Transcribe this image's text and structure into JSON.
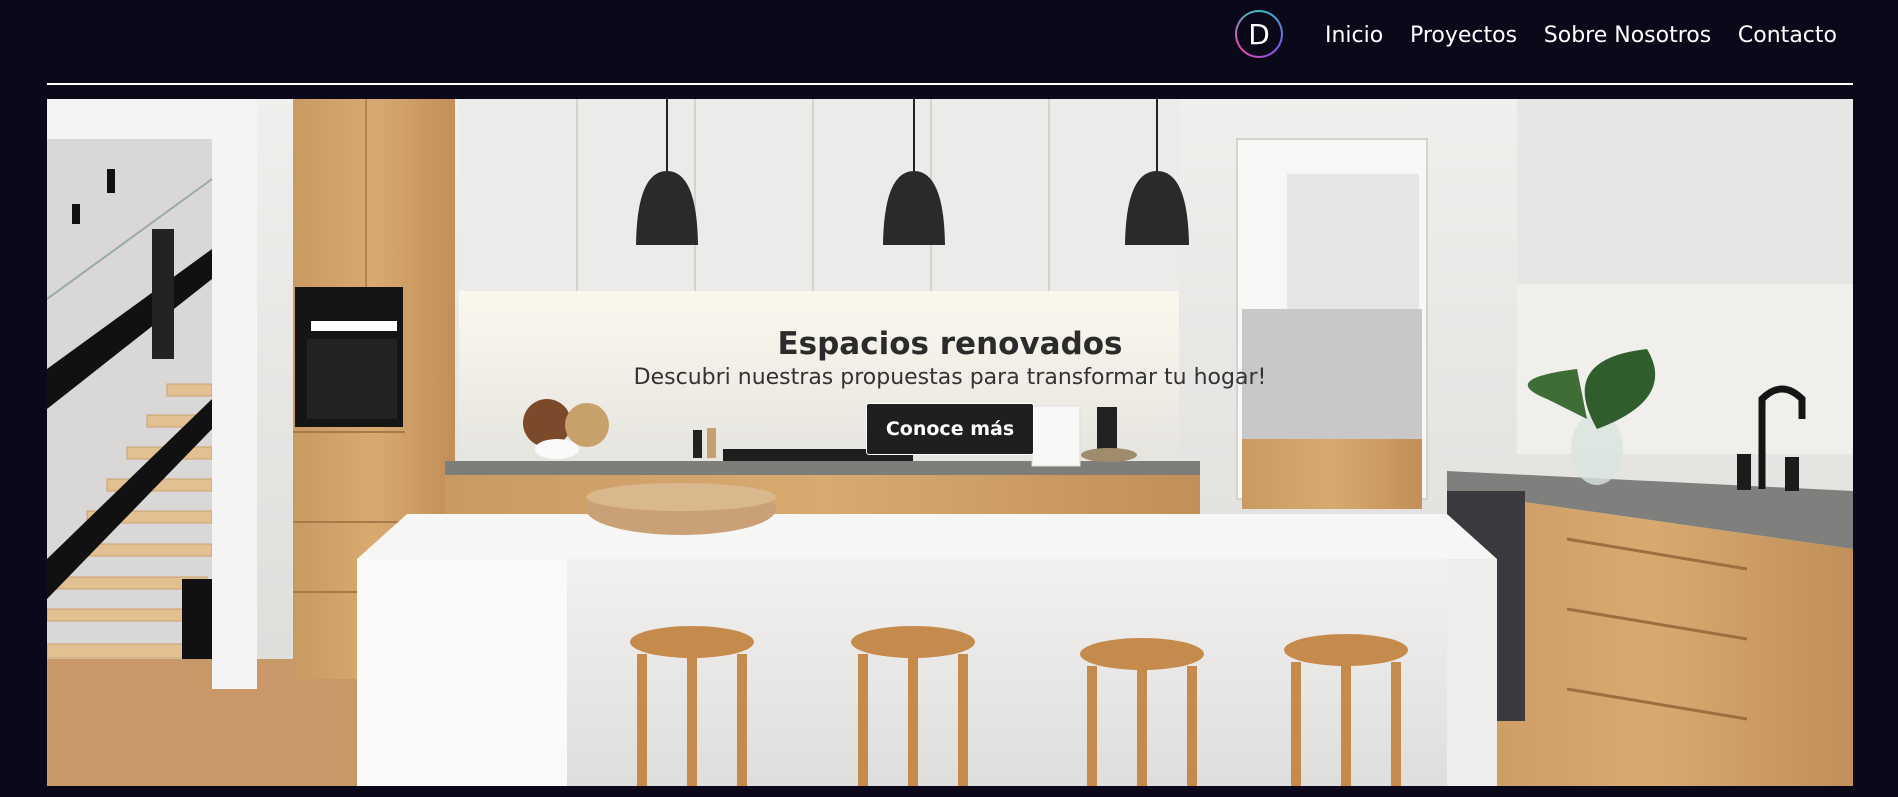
{
  "header": {
    "logo_letter": "D",
    "nav": [
      "Inicio",
      "Proyectos",
      "Sobre Nosotros",
      "Contacto"
    ]
  },
  "hero": {
    "title": "Espacios renovados",
    "subtitle": "Descubri nuestras propuestas para transformar tu hogar!",
    "button_label": "Conoce más"
  },
  "colors": {
    "background": "#0b0819",
    "text": "#ffffff",
    "button": "#1f1f1f"
  }
}
